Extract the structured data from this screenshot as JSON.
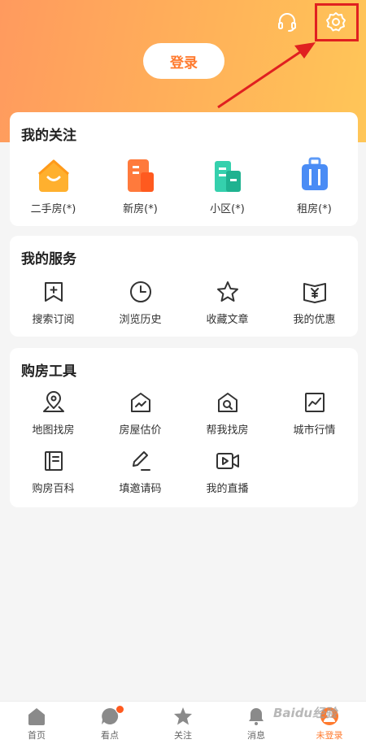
{
  "header": {
    "login_label": "登录",
    "icons": [
      "headset-icon",
      "gear-icon"
    ],
    "highlight_color": "#e02020"
  },
  "follow": {
    "title": "我的关注",
    "items": [
      {
        "label": "二手房(*)",
        "icon": "house-icon",
        "color": "#ffad2e"
      },
      {
        "label": "新房(*)",
        "icon": "new-building-icon",
        "color": "#ff6b2c"
      },
      {
        "label": "小区(*)",
        "icon": "community-icon",
        "color": "#26c1a0"
      },
      {
        "label": "租房(*)",
        "icon": "suitcase-icon",
        "color": "#4a8cf5"
      }
    ]
  },
  "services": {
    "title": "我的服务",
    "items": [
      {
        "label": "搜索订阅",
        "icon": "bookmark-plus-icon"
      },
      {
        "label": "浏览历史",
        "icon": "clock-icon"
      },
      {
        "label": "收藏文章",
        "icon": "star-icon"
      },
      {
        "label": "我的优惠",
        "icon": "coupon-icon"
      }
    ]
  },
  "tools": {
    "title": "购房工具",
    "items": [
      {
        "label": "地图找房",
        "icon": "map-pin-icon"
      },
      {
        "label": "房屋估价",
        "icon": "house-chart-icon"
      },
      {
        "label": "帮我找房",
        "icon": "house-search-icon"
      },
      {
        "label": "城市行情",
        "icon": "trend-chart-icon"
      },
      {
        "label": "购房百科",
        "icon": "book-icon"
      },
      {
        "label": "填邀请码",
        "icon": "pen-icon"
      },
      {
        "label": "我的直播",
        "icon": "video-icon"
      }
    ]
  },
  "tabbar": {
    "items": [
      {
        "label": "首页",
        "icon": "home-icon"
      },
      {
        "label": "看点",
        "icon": "chat-bubble-icon"
      },
      {
        "label": "关注",
        "icon": "star-icon"
      },
      {
        "label": "消息",
        "icon": "bell-icon"
      },
      {
        "label": "未登录",
        "icon": "avatar-icon"
      }
    ],
    "accent": "#ff7a2e"
  },
  "watermark": "Baidu经验"
}
